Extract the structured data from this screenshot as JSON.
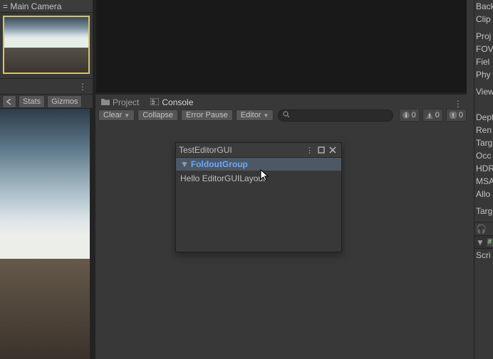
{
  "hierarchy": {
    "camera_label": "= Main Camera"
  },
  "game_toolbar": {
    "stats": "Stats",
    "gizmos": "Gizmos"
  },
  "tabs": {
    "project": "Project",
    "console": "Console"
  },
  "console_toolbar": {
    "clear": "Clear",
    "collapse": "Collapse",
    "error_pause": "Error Pause",
    "editor": "Editor",
    "log_count": "0",
    "warn_count": "0",
    "error_count": "0"
  },
  "floating_window": {
    "title": "TestEditorGUI",
    "foldout_label": "FoldoutGroup",
    "content_text": "Hello EditorGUILayout"
  },
  "inspector": {
    "rows_a": [
      "Back",
      "Clip"
    ],
    "rows_b": [
      "Proj",
      "FOV",
      "Fiel",
      "Phy"
    ],
    "rows_c": [
      "View"
    ],
    "rows_d": [
      "Dept",
      "Ren",
      "Targ",
      "Occ",
      "HDR",
      "MSA",
      "Allo"
    ],
    "rows_e": [
      "Targ"
    ],
    "script_row": "Scri"
  }
}
